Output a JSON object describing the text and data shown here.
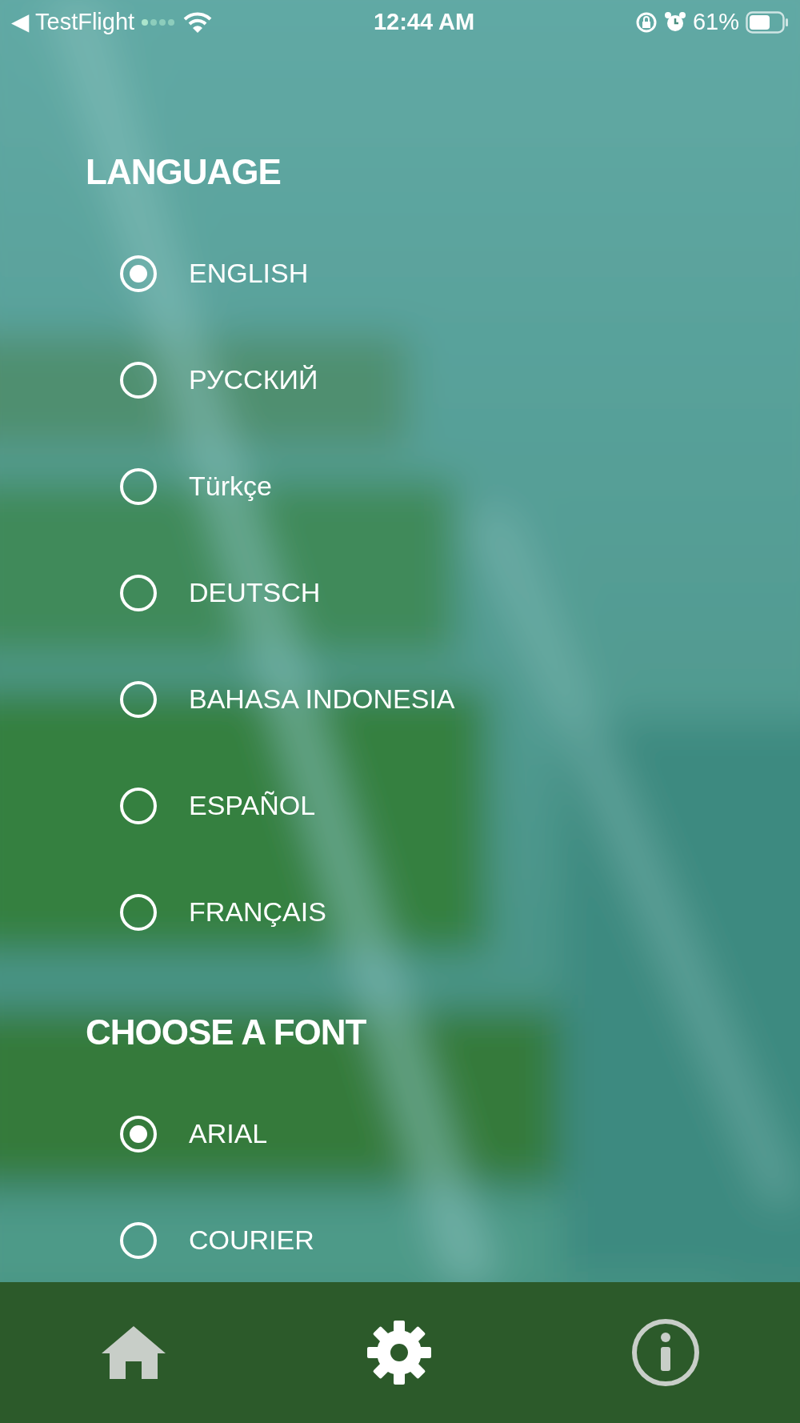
{
  "status_bar": {
    "back_arrow": "◀",
    "back_label": "TestFlight",
    "time": "12:44 AM",
    "battery_percent": "61%"
  },
  "sections": [
    {
      "title": "LANGUAGE",
      "options": [
        {
          "label": "ENGLISH",
          "selected": true
        },
        {
          "label": "РУССКИЙ",
          "selected": false
        },
        {
          "label": "Türkçe",
          "selected": false
        },
        {
          "label": "DEUTSCH",
          "selected": false
        },
        {
          "label": "BAHASA INDONESIA",
          "selected": false
        },
        {
          "label": "ESPAÑOL",
          "selected": false
        },
        {
          "label": "FRANÇAIS",
          "selected": false
        }
      ]
    },
    {
      "title": "CHOOSE A FONT",
      "options": [
        {
          "label": "ARIAL",
          "selected": true
        },
        {
          "label": "COURIER",
          "selected": false
        }
      ]
    }
  ],
  "tab_bar": {
    "items": [
      {
        "kind": "home",
        "selected": false
      },
      {
        "kind": "settings",
        "selected": true
      },
      {
        "kind": "info",
        "selected": false
      }
    ]
  }
}
